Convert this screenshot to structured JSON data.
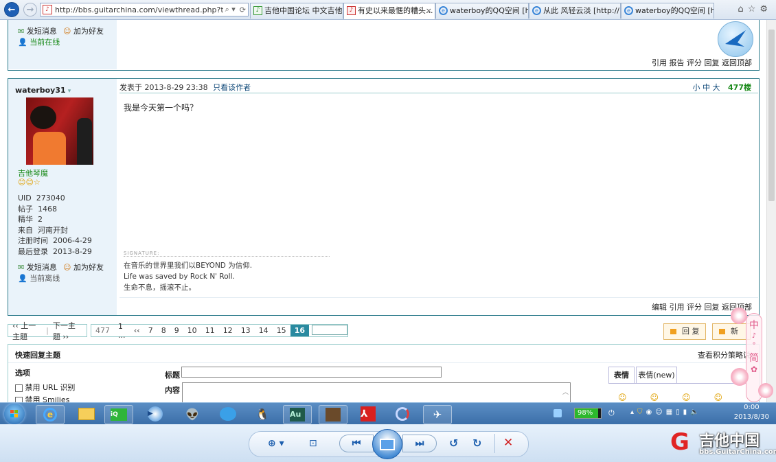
{
  "browser": {
    "url": "http://bbs.guitarchina.com/viewthread.php?tid",
    "tabs": [
      {
        "label": "吉他中国论坛 中文吉他...",
        "active": false
      },
      {
        "label": "有史以来最惬的糟头...",
        "active": true
      },
      {
        "label": "waterboy的QQ空间 [h...",
        "active": false
      },
      {
        "label": "从此 风轻云淡 [http://...",
        "active": false
      },
      {
        "label": "waterboy的QQ空间 [h...",
        "active": false
      }
    ],
    "close_glyph": "×"
  },
  "prev_post": {
    "send_message": "发短消息",
    "add_friend": "加为好友",
    "online_status": "当前在线",
    "actions": "引用 报告 评分 回复 返回顶部"
  },
  "post": {
    "username": "waterboy31",
    "user_title": "吉他琴魔",
    "stats": [
      {
        "label": "UID",
        "value": "273040"
      },
      {
        "label": "帖子",
        "value": "1468"
      },
      {
        "label": "精华",
        "value": "2"
      },
      {
        "label": "来自",
        "value": "河南开封"
      },
      {
        "label": "注册时间",
        "value": "2006-4-29"
      },
      {
        "label": "最后登录",
        "value": "2013-8-29"
      }
    ],
    "send_message": "发短消息",
    "add_friend": "加为好友",
    "offline_status": "当前离线",
    "posted_at": "发表于 2013-8-29 23:38",
    "author_only": "只看该作者",
    "font_sizes": "小 中 大",
    "floor": "477楼",
    "content": "我是今天第一个吗？",
    "signature_label": "SIGNATURE:",
    "signature_lines": [
      "在音乐的世界里我们以BEYOND 为信仰.",
      "Life was saved by Rock N' Roll.",
      "生命不息，摇滚不止。"
    ],
    "actions": "编辑 引用 评分 回复 返回顶部"
  },
  "pagination": {
    "prev_thread": "‹‹ 上一主题",
    "next_thread": "下一主题 ››",
    "total": "477",
    "first": "1 ...",
    "prev": "‹‹",
    "pages": [
      "7",
      "8",
      "9",
      "10",
      "11",
      "12",
      "13",
      "14",
      "15"
    ],
    "current": "16"
  },
  "buttons": {
    "reply": "回 复",
    "new": "新"
  },
  "quick_reply": {
    "title": "快速回复主题",
    "help_link": "查看积分策略说",
    "options_label": "选项",
    "options": [
      "禁用 URL 识别",
      "禁用 Smilies"
    ],
    "subject_label": "标题",
    "content_label": "内容",
    "emoji_tabs": [
      "表情",
      "表情(new)"
    ]
  },
  "side_widget": {
    "line1": "中",
    "line2": "简"
  },
  "taskbar": {
    "battery": "98%",
    "time": "0:00",
    "date": "2013/8/30",
    "au_label": "Au"
  },
  "watermark": {
    "cn": "吉他中国",
    "url": "bbs.GuitarChina.com"
  }
}
